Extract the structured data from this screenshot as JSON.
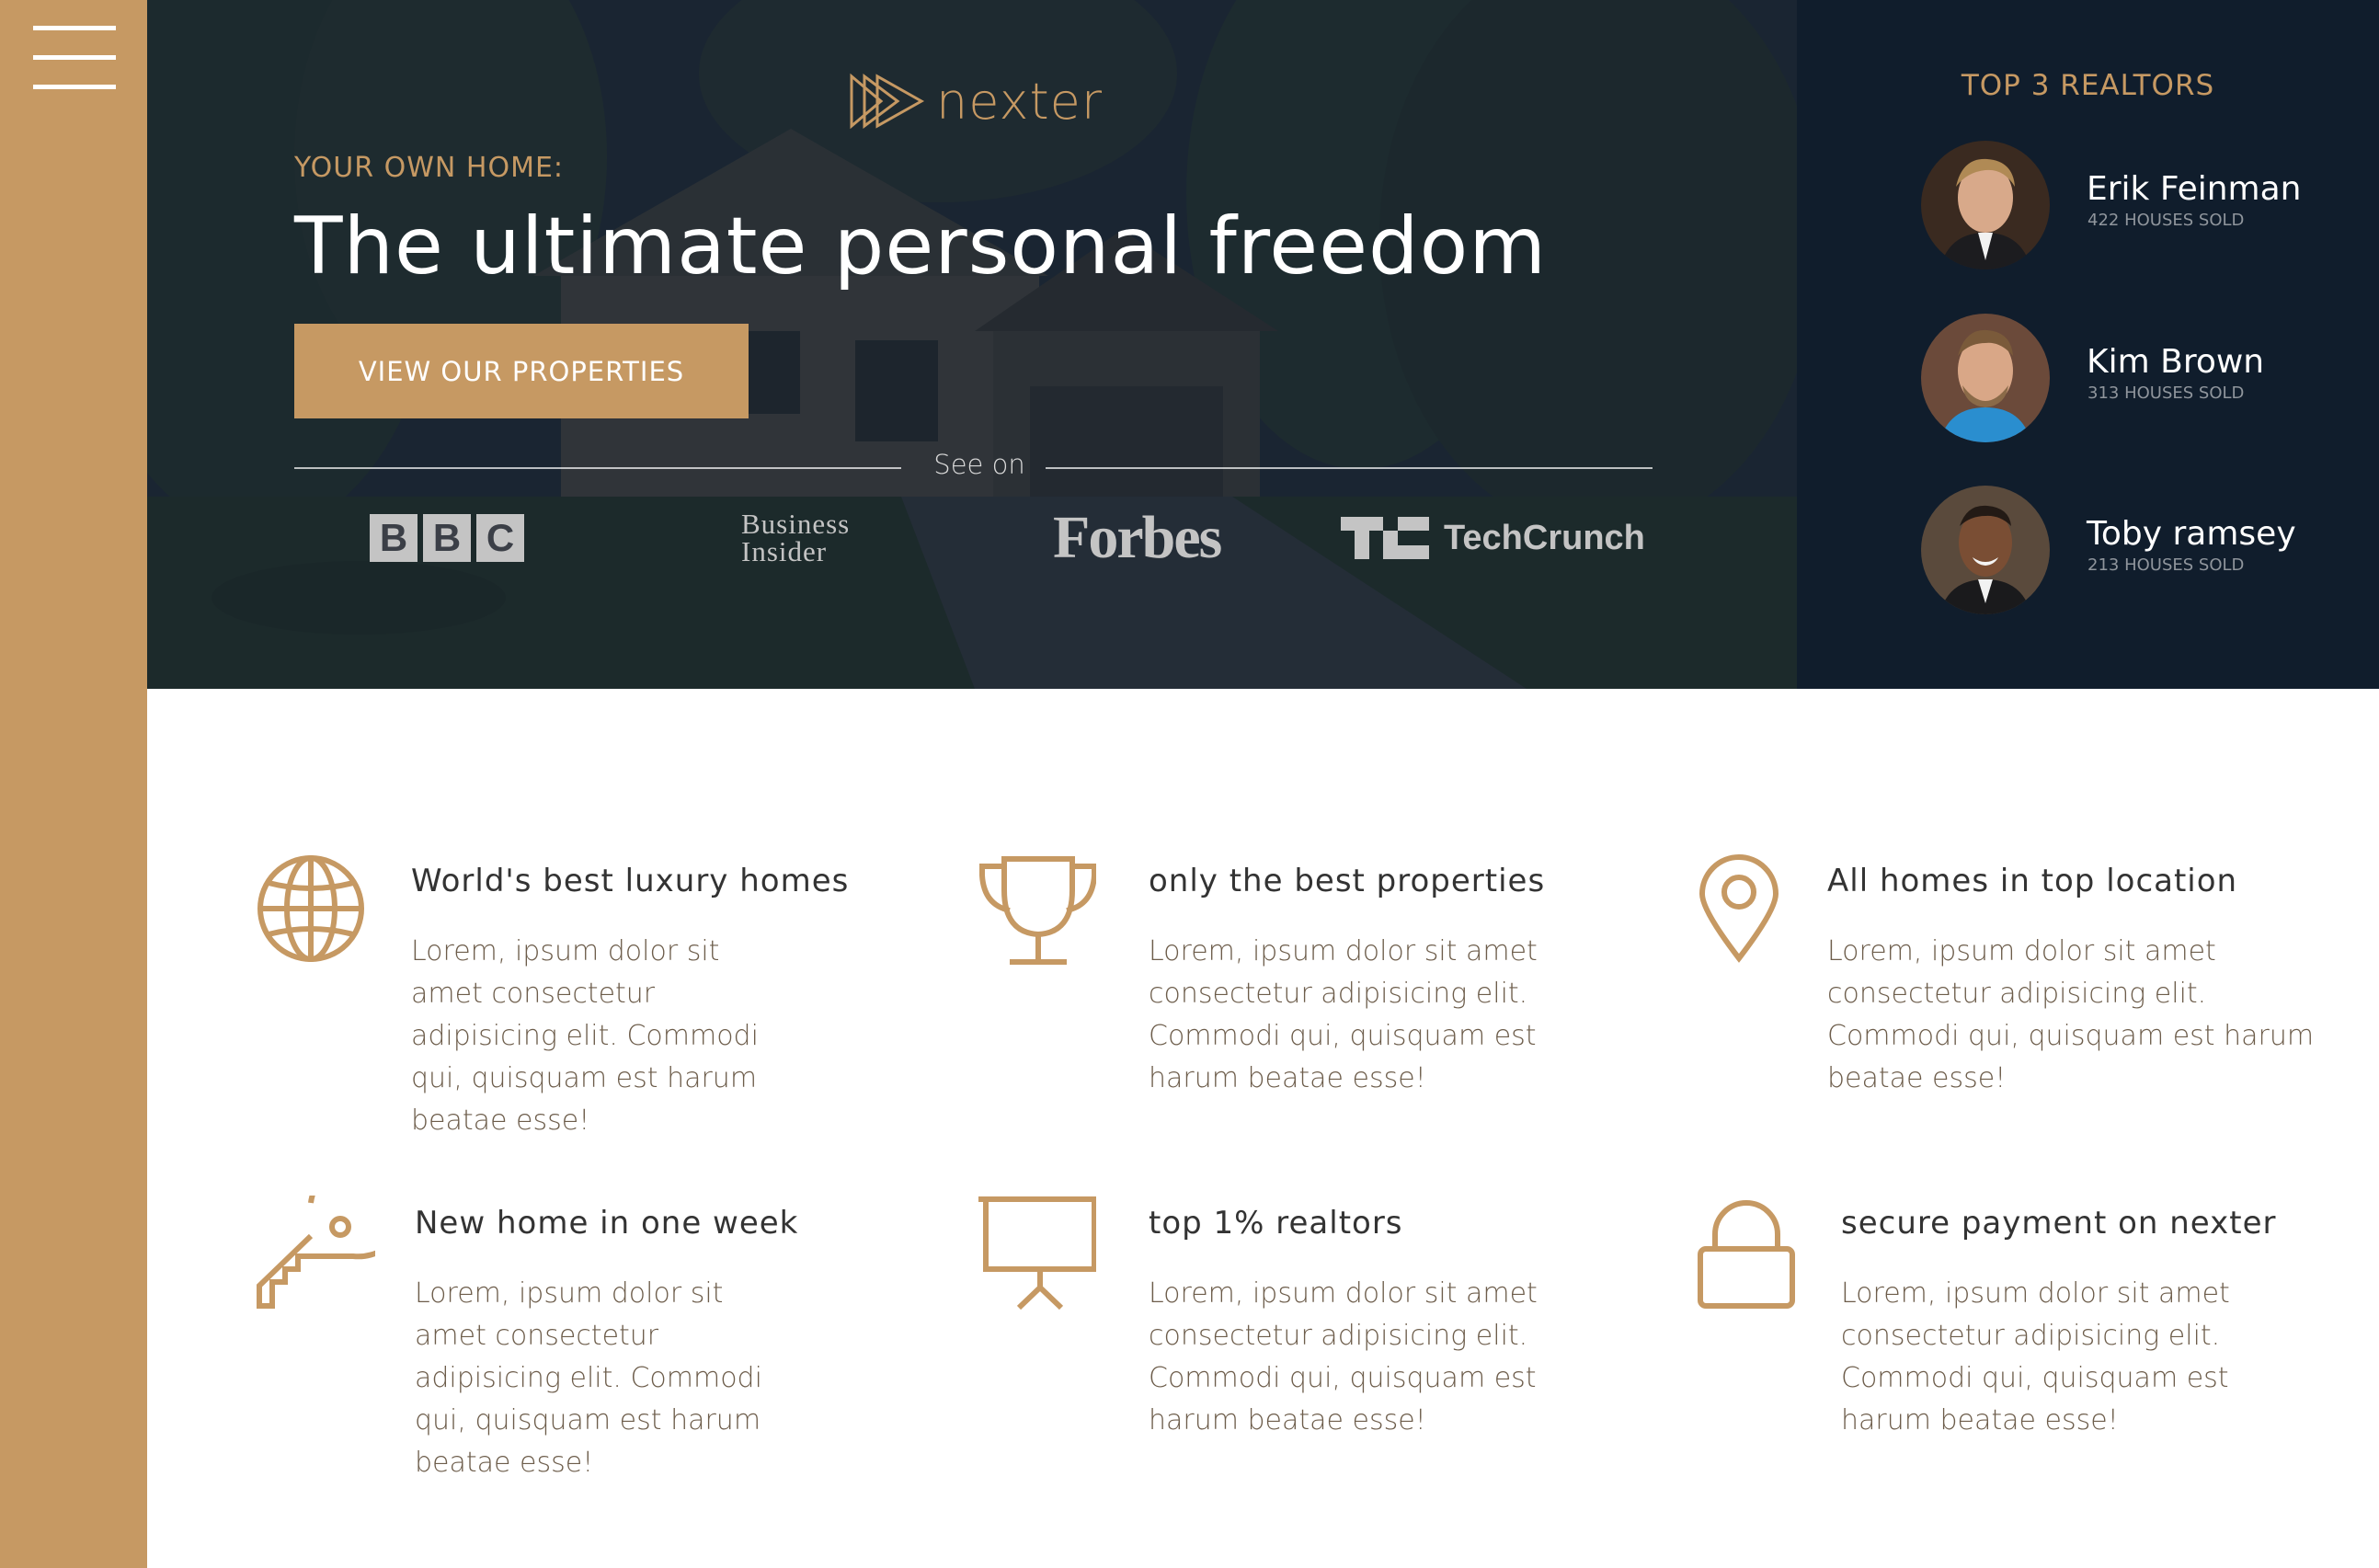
{
  "brand": {
    "name": "nexter",
    "accent_color": "#c69963",
    "dark_color": "#101d2c"
  },
  "sidebar": {
    "menu_icon": "hamburger-menu-icon"
  },
  "hero": {
    "subtitle": "YOUR OWN HOME:",
    "title": "The ultimate personal freedom",
    "cta_label": "VIEW OUR PROPERTIES",
    "see_on_label": "See on",
    "press": {
      "bbc": [
        "B",
        "B",
        "C"
      ],
      "business_insider": [
        "Business",
        "Insider"
      ],
      "forbes": "Forbes",
      "techcrunch": "TechCrunch"
    }
  },
  "realtors": {
    "title": "TOP 3 REALTORS",
    "items": [
      {
        "name": "Erik Feinman",
        "sold": "422 HOUSES SOLD"
      },
      {
        "name": "Kim Brown",
        "sold": "313 HOUSES SOLD"
      },
      {
        "name": "Toby ramsey",
        "sold": "213 HOUSES SOLD"
      }
    ]
  },
  "features": [
    {
      "icon": "globe-icon",
      "title": "World's best luxury homes",
      "text": "Lorem, ipsum dolor sit amet consectetur adipisicing elit. Commodi qui, quisquam est harum beatae esse!"
    },
    {
      "icon": "trophy-icon",
      "title": "only the best properties",
      "text": "Lorem, ipsum dolor sit amet consectetur adipisicing elit. Commodi qui, quisquam est harum beatae esse!"
    },
    {
      "icon": "map-pin-icon",
      "title": "All homes in top location",
      "text": "Lorem, ipsum dolor sit amet consectetur adipisicing elit. Commodi qui, quisquam est harum beatae esse!"
    },
    {
      "icon": "key-icon",
      "title": "New home in one week",
      "text": "Lorem, ipsum dolor sit amet consectetur adipisicing elit. Commodi qui, quisquam est harum beatae esse!"
    },
    {
      "icon": "presentation-icon",
      "title": "top 1% realtors",
      "text": "Lorem, ipsum dolor sit amet consectetur adipisicing elit. Commodi qui, quisquam est harum beatae esse!"
    },
    {
      "icon": "lock-icon",
      "title": "secure payment on nexter",
      "text": "Lorem, ipsum dolor sit amet consectetur adipisicing elit. Commodi qui, quisquam est harum beatae esse!"
    }
  ]
}
